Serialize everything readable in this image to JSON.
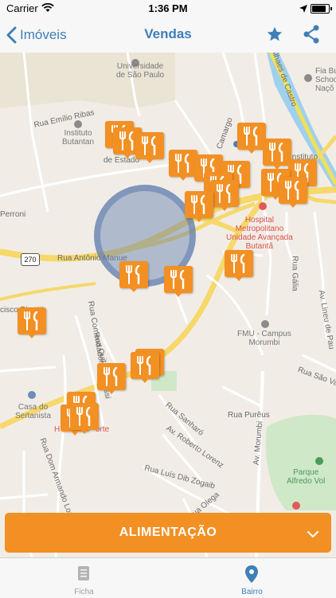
{
  "status_bar": {
    "carrier": "Carrier",
    "time": "1:36 PM"
  },
  "nav": {
    "back_label": "Imóveis",
    "title": "Vendas"
  },
  "map": {
    "labels": {
      "universidade_l1": "Universidade",
      "universidade_l2": "de São Paulo",
      "instituto_l1": "Instituto",
      "instituto_l2": "Butantan",
      "rua_emilio": "Rua Emílio Ribas",
      "perroni": "Perroni",
      "rua_antonio": "Rua Antônio Manue",
      "francisco": "cisco Pirrotti",
      "hospital_l1": "Hospital",
      "hospital_l2": "Metropolitano",
      "hospital_l3": "Unidade Avançada",
      "hospital_l4": "Butantã",
      "fmu_l1": "FMU - Campus",
      "fmu_l2": "Morumbi",
      "casa_l1": "Casa do",
      "casa_l2": "Sertanista",
      "rua_sapucai": "Rua Sapucaí",
      "rua_galia": "Rua Gália",
      "av_lineu": "Av. Lineu de Pau",
      "rua_sao_valerio": "Rua São Valério",
      "rua_purcus": "Rua Purêus",
      "av_morumbi": "Av. Morumbi",
      "rua_sanharo": "Rua Sanharó",
      "av_roberto": "Av. Roberto Lorenz",
      "rua_luis": "Rua Luís Dib Zogaib",
      "rua_olega": "Rua Olega",
      "parque_l1": "Parque",
      "parque_l2": "Alfredo Vol",
      "fia_l1": "Fia Bu",
      "fia_l2": "Schoo",
      "fia_l3": "Naçõ",
      "rua_quitara": "Rua Quitara",
      "rua_comendador": "Rua Comendador Elias Assi",
      "rua_dom": "Rua Dom Armando Lombardi",
      "camargo": "Camargo",
      "castro": "Alhaes de Castro",
      "de_estado": "de Estado",
      "huporte": "H",
      "huporte2": "orte",
      "route": "270",
      "instituto_small": "Instituto"
    }
  },
  "category_button": {
    "label": "ALIMENTAÇÃO"
  },
  "tabs": [
    {
      "label": "Ficha"
    },
    {
      "label": "Bairro"
    }
  ]
}
